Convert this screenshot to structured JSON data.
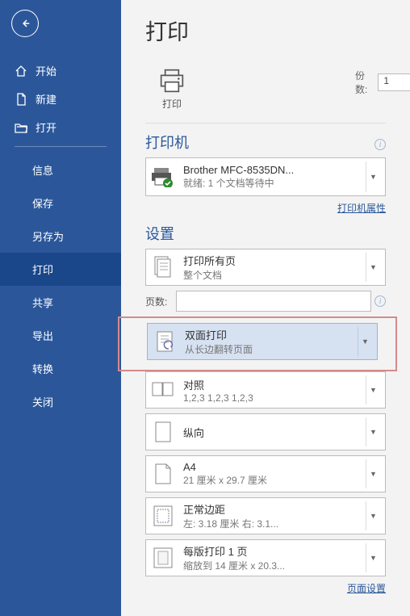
{
  "sidebar": {
    "top": [
      {
        "label": "开始",
        "icon": "home"
      },
      {
        "label": "新建",
        "icon": "doc"
      },
      {
        "label": "打开",
        "icon": "folder"
      }
    ],
    "sub": [
      "信息",
      "保存",
      "另存为",
      "打印",
      "共享",
      "导出",
      "转换",
      "关闭"
    ],
    "active_index": 3
  },
  "page": {
    "title": "打印",
    "print_label": "打印",
    "copies_label": "份数:",
    "copies_value": "1"
  },
  "printer": {
    "section_title": "打印机",
    "name": "Brother MFC-8535DN...",
    "status": "就绪: 1 个文档等待中",
    "properties_link": "打印机属性"
  },
  "settings": {
    "section_title": "设置",
    "pages_label": "页数:",
    "pages_value": "",
    "page_setup_link": "页面设置",
    "items": [
      {
        "title": "打印所有页",
        "sub": "整个文档",
        "icon": "pages-all"
      },
      {
        "title": "双面打印",
        "sub": "从长边翻转页面",
        "icon": "duplex",
        "highlighted": true
      },
      {
        "title": "对照",
        "sub": "1,2,3    1,2,3    1,2,3",
        "icon": "collate"
      },
      {
        "title": "纵向",
        "sub": "",
        "icon": "portrait"
      },
      {
        "title": "A4",
        "sub": "21 厘米 x 29.7 厘米",
        "icon": "papersize"
      },
      {
        "title": "正常边距",
        "sub": "左:  3.18 厘米   右:  3.1...",
        "icon": "margins"
      },
      {
        "title": "每版打印 1 页",
        "sub": "缩放到 14 厘米 x 20.3...",
        "icon": "npages"
      }
    ]
  }
}
